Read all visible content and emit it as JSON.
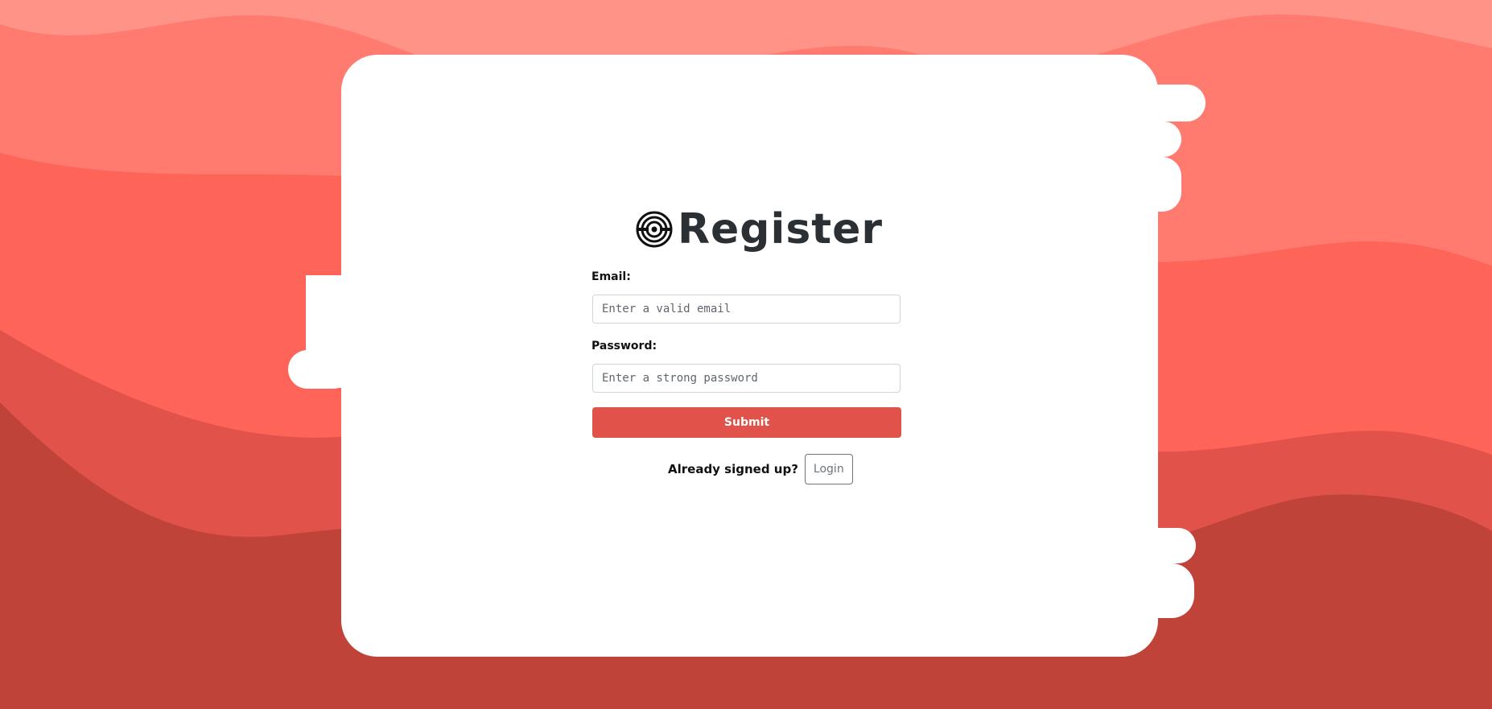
{
  "page": {
    "title": "Register",
    "logo_icon": "target-logo-icon"
  },
  "form": {
    "email_label": "Email:",
    "email_placeholder": "Enter a valid email",
    "email_value": "",
    "password_label": "Password:",
    "password_placeholder": "Enter a strong password",
    "password_value": "",
    "submit_label": "Submit"
  },
  "login": {
    "prompt": "Already signed up?",
    "button_label": "Login"
  },
  "colors": {
    "background_light": "#ff9388",
    "background_mid": "#ff6459",
    "background_dark": "#bf4339",
    "submit": "#e0524a",
    "title": "#2b3035"
  }
}
